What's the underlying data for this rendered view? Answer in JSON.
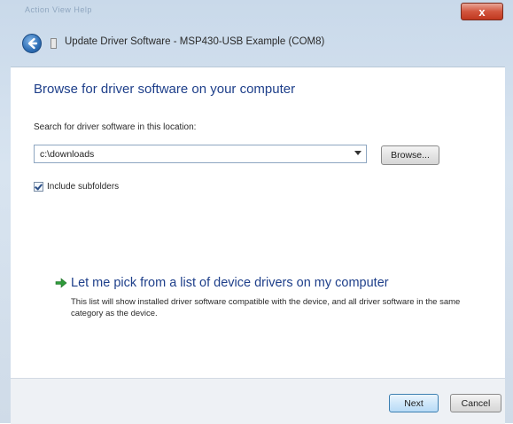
{
  "window": {
    "title": "Update Driver Software - MSP430-USB Example (COM8)",
    "faint_menu": "Action   View   Help",
    "close_glyph": "x"
  },
  "heading": "Browse for driver software on your computer",
  "search": {
    "label": "Search for driver software in this location:",
    "value": "c:\\downloads",
    "browse_label": "Browse..."
  },
  "include_subfolders": {
    "label": "Include subfolders",
    "checked": true
  },
  "pick_option": {
    "title": "Let me pick from a list of device drivers on my computer",
    "description": "This list will show installed driver software compatible with the device, and all driver software in the same category as the device."
  },
  "footer": {
    "next_label": "Next",
    "cancel_label": "Cancel"
  },
  "colors": {
    "accent_text": "#1e3f8a",
    "close_red": "#c0381f",
    "pick_arrow_green": "#2e9a3a"
  },
  "icons": {
    "back": "back-arrow-icon",
    "close": "close-icon",
    "device": "device-icon",
    "pick": "green-arrow-icon",
    "dropdown": "chevron-down-icon"
  }
}
